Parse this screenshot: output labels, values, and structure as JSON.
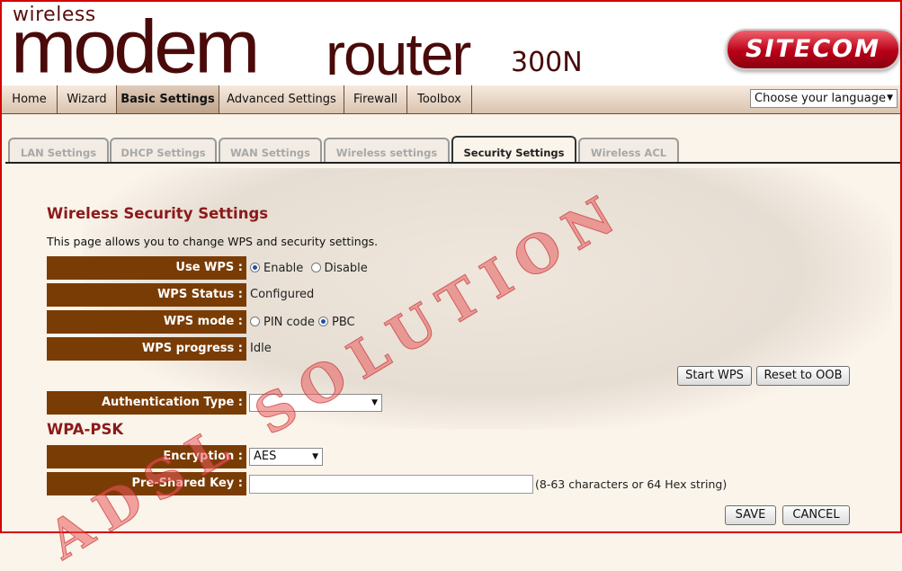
{
  "header": {
    "brand_top": "wireless",
    "brand_main": "modem",
    "brand_router": "router",
    "brand_model": "300N",
    "logo": "SITECOM"
  },
  "nav": {
    "items": [
      "Home",
      "Wizard",
      "Basic Settings",
      "Advanced Settings",
      "Firewall",
      "Toolbox"
    ],
    "active": "Basic Settings",
    "language_select": "Choose your language"
  },
  "tabs": {
    "items": [
      "LAN Settings",
      "DHCP Settings",
      "WAN Settings",
      "Wireless settings",
      "Security Settings",
      "Wireless ACL"
    ],
    "active": "Security Settings"
  },
  "watermark": "ADSL SOLUTION",
  "page": {
    "title": "Wireless Security Settings",
    "description": "This page allows you to change WPS and security settings."
  },
  "wps": {
    "use_wps_label": "Use WPS :",
    "enable_label": "Enable",
    "disable_label": "Disable",
    "use_wps_value": "Enable",
    "status_label": "WPS Status :",
    "status_value": "Configured",
    "mode_label": "WPS mode :",
    "pin_code_label": "PIN code",
    "pbc_label": "PBC",
    "mode_value": "PBC",
    "progress_label": "WPS progress :",
    "progress_value": "Idle",
    "start_button": "Start WPS",
    "reset_button": "Reset to OOB"
  },
  "auth": {
    "label": "Authentication Type :",
    "value": ""
  },
  "wpa_psk": {
    "section_title": "WPA-PSK",
    "encryption_label": "Encryption :",
    "encryption_value": "AES",
    "psk_label": "Pre-Shared Key :",
    "psk_value": "",
    "psk_hint": "(8-63 characters or 64 Hex string)"
  },
  "actions": {
    "save": "SAVE",
    "cancel": "CANCEL"
  },
  "colors": {
    "label_bg": "#7a3c05",
    "title": "#8b1a1a",
    "logo": "#b80018",
    "frame": "#d40000"
  }
}
